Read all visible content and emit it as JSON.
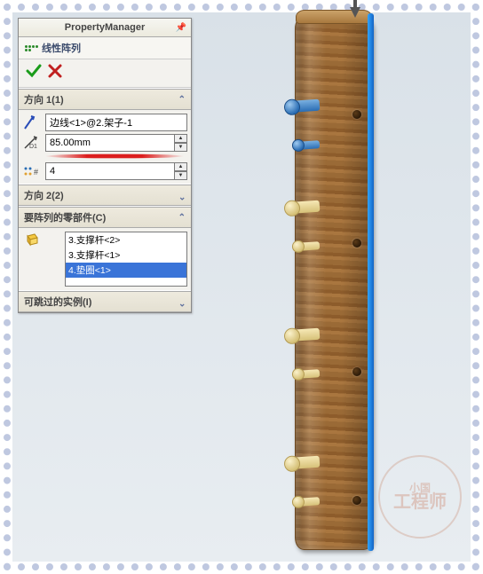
{
  "pm_title": "PropertyManager",
  "feature_title": "线性阵列",
  "direction1": {
    "header": "方向 1(1)",
    "edge": "边线<1>@2.架子-1",
    "spacing": "85.00mm",
    "instances": "4"
  },
  "direction2": {
    "header": "方向 2(2)"
  },
  "components": {
    "header": "要阵列的零部件(C)",
    "items": [
      "3.支撑杆<2>",
      "3.支撑杆<1>",
      "4.垫圈<1>"
    ],
    "selected_index": 2
  },
  "skip": {
    "header": "可跳过的实例(I)"
  },
  "watermark": {
    "small": "小国",
    "big": "工程师"
  }
}
